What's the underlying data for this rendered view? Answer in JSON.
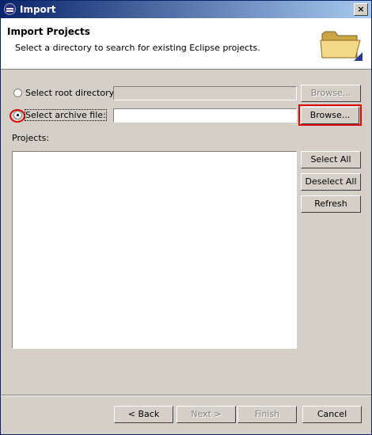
{
  "window": {
    "title": "Import",
    "close_glyph": "×"
  },
  "header": {
    "title": "Import Projects",
    "description": "Select a directory to search for existing Eclipse projects."
  },
  "options": {
    "root_directory": {
      "label": "Select root directory:",
      "value": "",
      "selected": false,
      "browse_label": "Browse...",
      "browse_enabled": false
    },
    "archive_file": {
      "label": "Select archive file:",
      "value": "",
      "selected": true,
      "browse_label": "Browse...",
      "browse_enabled": true
    }
  },
  "projects": {
    "label": "Projects:",
    "items": []
  },
  "list_buttons": {
    "select_all": "Select All",
    "deselect_all": "Deselect All",
    "refresh": "Refresh"
  },
  "footer": {
    "back": "< Back",
    "next": "Next >",
    "finish": "Finish",
    "cancel": "Cancel"
  },
  "annotation_color": "#e00000",
  "icons": {
    "window": "eclipse-icon",
    "close": "close-icon",
    "header": "folder-icon"
  }
}
